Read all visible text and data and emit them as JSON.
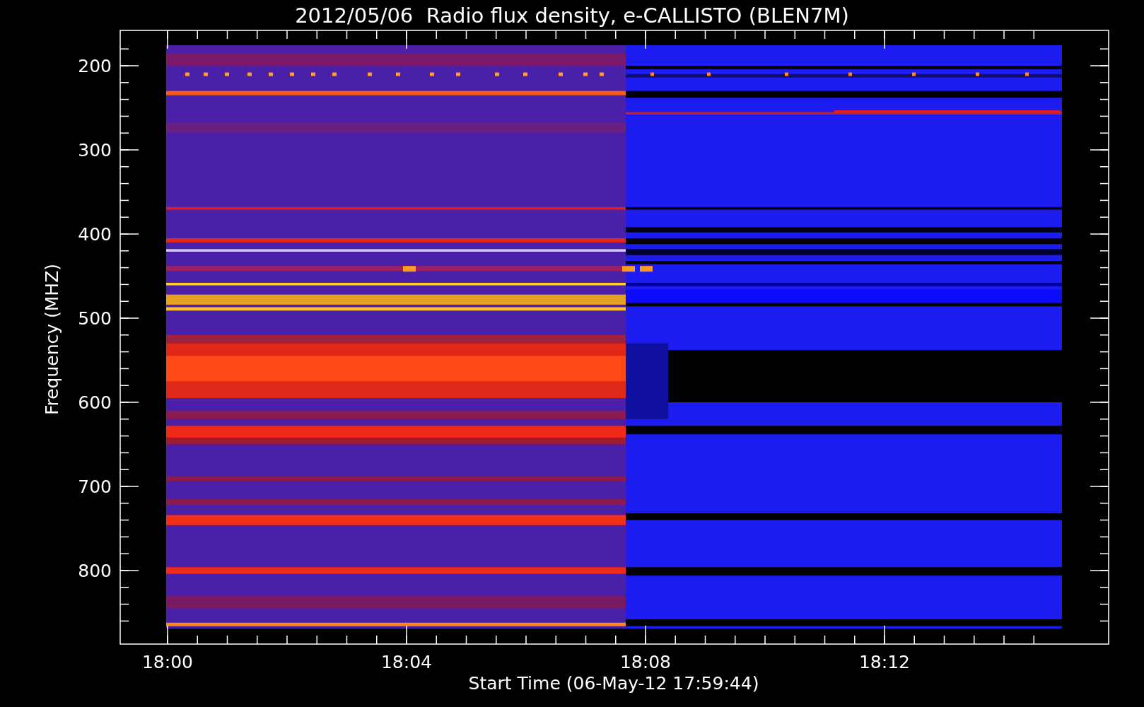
{
  "chart": {
    "title": "2012/05/06  Radio flux density, e-CALLISTO (BLEN7M)",
    "ylabel": "Frequency (MHZ)",
    "xlabel": "Start Time (06-May-12 17:59:44)",
    "yticks": [
      "200",
      "300",
      "400",
      "500",
      "600",
      "700",
      "800"
    ],
    "xticks": [
      "18:00",
      "18:04",
      "18:08",
      "18:12"
    ]
  }
}
